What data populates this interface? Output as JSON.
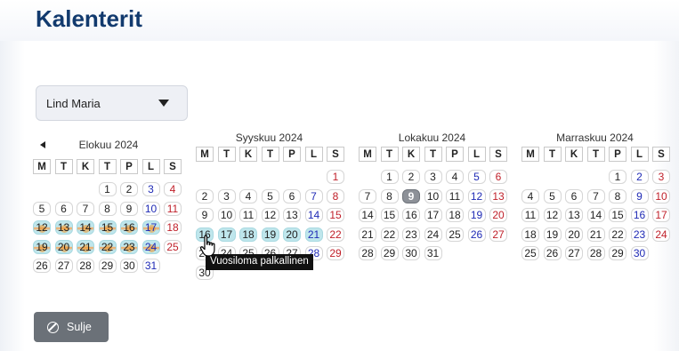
{
  "page": {
    "title": "Kalenterit"
  },
  "person_select": {
    "selected": "Lind Maria"
  },
  "weekdays": [
    "M",
    "T",
    "K",
    "T",
    "P",
    "L",
    "S"
  ],
  "months": [
    {
      "name": "Elokuu 2024",
      "first_weekday": 3,
      "days": 31,
      "vacation_days": [
        12,
        13,
        14,
        15,
        16,
        17,
        19,
        20,
        21,
        22,
        23,
        24
      ],
      "today": null,
      "has_prev": true
    },
    {
      "name": "Syyskuu 2024",
      "first_weekday": 6,
      "days": 30,
      "vacation_days": [
        16,
        17,
        18,
        19,
        20,
        21
      ],
      "today": null,
      "has_prev": false
    },
    {
      "name": "Lokakuu 2024",
      "first_weekday": 1,
      "days": 31,
      "vacation_days": [],
      "today": 9,
      "has_prev": false
    },
    {
      "name": "Marraskuu 2024",
      "first_weekday": 4,
      "days": 30,
      "vacation_days": [],
      "today": null,
      "has_prev": false
    }
  ],
  "tooltip": {
    "text": "Vuosiloma palkallinen"
  },
  "close_button": {
    "label": "Sulje"
  },
  "colors": {
    "saturday": "#1f2ab5",
    "sunday": "#c0202a",
    "vacation": "#bfe6ec",
    "title": "#123a6e"
  }
}
